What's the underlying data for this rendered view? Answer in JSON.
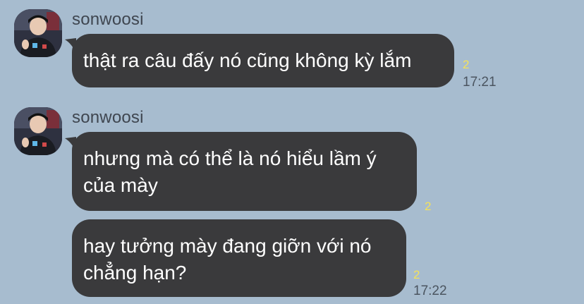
{
  "chat": {
    "groups": [
      {
        "sender": "sonwoosi",
        "avatar_icon": "profile-photo-icon",
        "messages": [
          {
            "text": "thật ra câu đấy nó cũng không kỳ lắm",
            "unread": "2",
            "time": "17:21"
          }
        ]
      },
      {
        "sender": "sonwoosi",
        "avatar_icon": "profile-photo-icon",
        "messages": [
          {
            "text": "nhưng mà có thể là nó hiểu lầm ý\ncủa mày",
            "unread": "2",
            "time": ""
          },
          {
            "text": "hay tưởng mày đang giỡn với nó\nchẳng hạn?",
            "unread": "2",
            "time": "17:22"
          }
        ]
      }
    ]
  },
  "colors": {
    "background": "#a7bccf",
    "bubble": "#3a3a3c",
    "bubble_text": "#ffffff",
    "unread_count": "#f4e25a",
    "timestamp": "#4b5560",
    "sender_name": "#3f4650"
  }
}
